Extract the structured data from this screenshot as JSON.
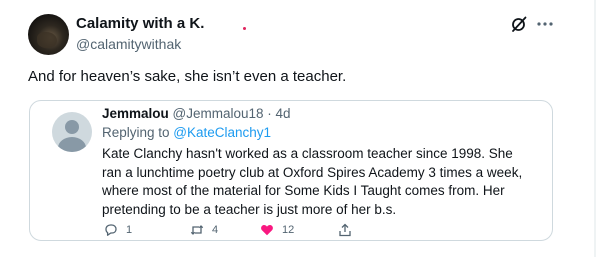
{
  "tweet": {
    "display_name": "Calamity with a K.",
    "handle": "@calamitywithak",
    "text": "And for heaven’s sake, she isn’t even a teacher.",
    "icons": [
      "grok-icon",
      "more-icon"
    ]
  },
  "quote": {
    "name": "Jemmalou",
    "handle_time": "@Jemmalou18 · 4d",
    "replying_prefix": "Replying to ",
    "replying_mention": "@KateClanchy1",
    "body_lines": [
      "Kate Clanchy hasn't worked as a classroom teacher since 1998. She",
      "ran a lunchtime poetry club at Oxford Spires Academy 3 times a week,",
      "where most of the material for Some Kids I Taught comes from. Her",
      "pretending to be a teacher is just more of her b.s."
    ],
    "actions": {
      "replies": "1",
      "retweets": "4",
      "likes": "12"
    }
  },
  "colors": {
    "text": "#0f1419",
    "secondary": "#536471",
    "link": "#1d9bf0",
    "like": "#f91880",
    "border": "#cfd9de"
  }
}
